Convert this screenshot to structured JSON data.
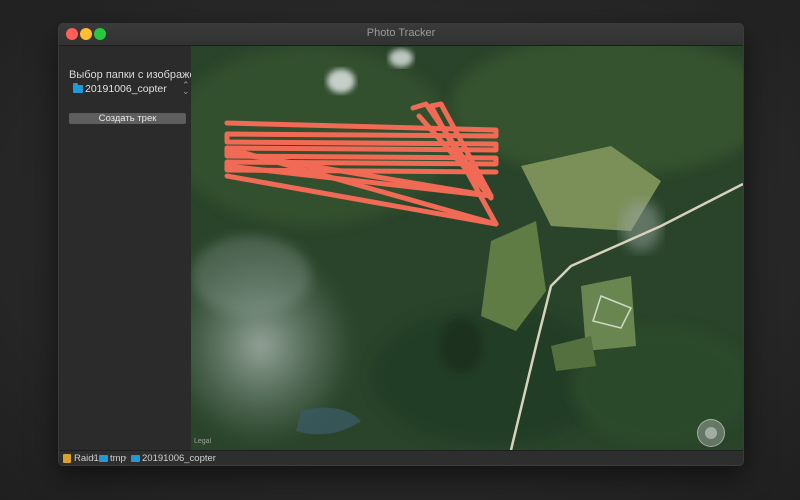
{
  "window": {
    "title": "Photo Tracker"
  },
  "sidebar": {
    "folder_label": "Выбор папки с изображениями",
    "selected_folder": "20191006_copter",
    "create_button": "Создать трек"
  },
  "map": {
    "legal": "Legal",
    "zoom_out": "−",
    "zoom_in": "+",
    "track_color": "#f06a55"
  },
  "pathbar": {
    "items": [
      "Raid1",
      "tmp",
      "20191006_copter"
    ],
    "separator": "›"
  },
  "colors": {
    "close": "#ff5f57",
    "minimize": "#febc2e",
    "maximize": "#28c840",
    "folder": "#1f9ad6"
  }
}
